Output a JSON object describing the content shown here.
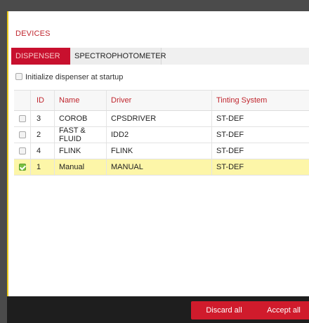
{
  "dialog": {
    "title": "DEVICES",
    "tabs": [
      {
        "label": "DISPENSER",
        "active": true
      },
      {
        "label": "SPECTROPHOTOMETER",
        "active": false
      }
    ],
    "init_checkbox": {
      "label": "Initialize dispenser at startup",
      "checked": false
    }
  },
  "table": {
    "columns": [
      "",
      "ID",
      "Name",
      "Driver",
      "Tinting System"
    ],
    "rows": [
      {
        "checked": false,
        "id": "3",
        "name": "COROB",
        "driver": "CPSDRIVER",
        "tint": "ST-DEF"
      },
      {
        "checked": false,
        "id": "2",
        "name": "FAST & FLUID",
        "driver": "IDD2",
        "tint": "ST-DEF"
      },
      {
        "checked": false,
        "id": "4",
        "name": "FLINK",
        "driver": "FLINK",
        "tint": "ST-DEF"
      },
      {
        "checked": true,
        "id": "1",
        "name": "Manual",
        "driver": "MANUAL",
        "tint": "ST-DEF"
      }
    ]
  },
  "footer": {
    "discard_label": "Discard all",
    "accept_label": "Accept all"
  },
  "colors": {
    "accent": "#c8102e",
    "selected_row": "#fdf6a8",
    "check_green": "#7ac142"
  }
}
